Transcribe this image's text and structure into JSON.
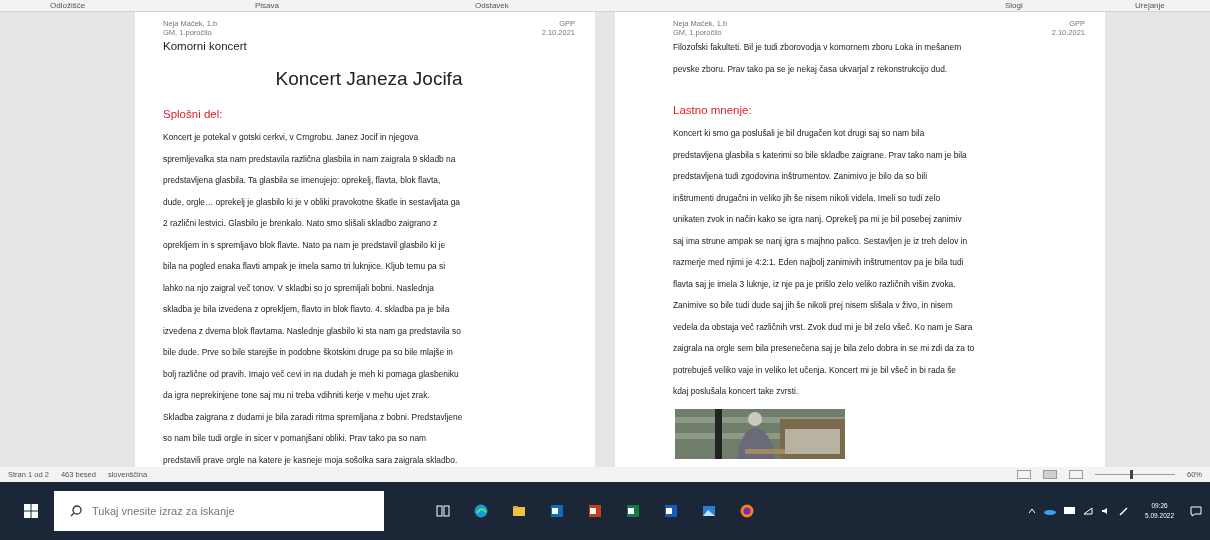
{
  "ribbon_groups": [
    "Odložišče",
    "Pisava",
    "Odstavek",
    "Slogi",
    "Urejanje"
  ],
  "pages": [
    {
      "header": {
        "author": "Neja Maček, 1.b",
        "subject": "GPP",
        "date": "2.10.2021",
        "report": "GM, 1.poročilo"
      },
      "blocks": [
        {
          "kind": "subtitle",
          "text": "Komorni koncert"
        },
        {
          "kind": "title",
          "text": "Koncert Janeza Jocifa"
        },
        {
          "kind": "heading",
          "text": "Splošni del:"
        },
        {
          "kind": "paragraph",
          "lines": [
            "Koncert je potekal v gotski cerkvi, v Crngrobu. Janez Jocif in njegova",
            "spremljevalka sta nam predstavila različna glasbila in nam zaigrala 9 skladb na",
            "predstavljena glasbila. Ta glasbila se imenujejo: oprekelj, flavta, blok flavta,",
            "dude, orgle… oprekelj je glasbilo ki je v obliki pravokotne škatle in sestavljata ga",
            "2 različni lestvici. Glasbilo je brenkalo. Nato smo slišali skladbo zaigrano z",
            "oprekljem in s spremljavo blok flavte. Nato pa nam je predstavil glasbilo ki je",
            "bila na pogled enaka flavti ampak je imela samo tri luknjice. Kljub temu pa si",
            "lahko na njo zaigral več tonov. V skladbi so jo spremljali bobni. Naslednja",
            "skladba je bila izvedena z oprekljem, flavto in blok flavto. 4. skladba pa je bila",
            "izvedena z dvema blok flavtama. Naslednje glasbilo ki sta nam ga predstavila so",
            "bile dude. Prve so bile starejše in podobne škotskim druge pa so bile mlajše in",
            "bolj različne od pravih. Imajo več cevi in na dudah je meh ki pomaga glasbeniku",
            "da igra neprekinjene tone saj mu ni treba vdihniti kerje v mehu ujet zrak.",
            "Skladba zaigrana z dudami je bila zaradi ritma spremljana z bobni. Predstavljene",
            "so nam bile tudi orgle in sicer v  pomanjšani obliki. Prav tako pa so nam",
            "predstavili prave orgle na katere je kasneje moja sošolka sara zaigrala skladbo."
          ]
        }
      ]
    },
    {
      "header": {
        "author": "Neja Maček, 1.b",
        "subject": "GPP",
        "date": "2.10.2021",
        "report": "GM, 1.poročilo"
      },
      "blocks": [
        {
          "kind": "paragraph",
          "lines": [
            "Filozofski fakulteti. Bil je tudi zborovodja v komornem zboru Loka in mešanem",
            "pevske zboru. Prav tako pa se je nekaj časa ukvarjal z rekonstrukcijo dud."
          ]
        },
        {
          "kind": "heading",
          "text": "Lastno mnenje:"
        },
        {
          "kind": "paragraph",
          "lines": [
            "Koncert ki smo ga poslušali je bil drugačen kot drugi saj so nam bila",
            "predstavljena glasbila s katerimi so bile skladbe zaigrane. Prav tako nam je bila",
            "predstavljena tudi zgodovina inštrumentov. Zanimivo je bilo da so bili",
            "inštrumenti drugačni in veliko jih še nisem nikoli videla. Imeli so tudi zelo",
            "unikaten zvok in način kako se igra nanj. Oprekelj pa mi je bil posebej zanimiv",
            "saj ima strune ampak se nanj igra s majhno palico. Sestavljen je iz treh delov in",
            "razmerje med njimi je 4:2:1. Eden najbolj zanimivih inštrumentov pa je bila tudi",
            "flavta saj je imela 3 luknje, iz nje pa je prišlo zelo veliko različnih višin zvoka.",
            "Zanimive so bile tudi dude saj jih še nikoli prej nisem slišala v živo, in nisem",
            "vedela da obstaja več različnih vrst. Zvok dud mi je bil zelo všeč. Ko nam je Sara",
            "zaigrala na orgle sem bila presenečena saj je bila zelo dobra in se mi zdi da za to",
            "potrebuješ veliko vaje in veliko let učenja. Koncert mi je bil všeč in bi rada še",
            "kdaj poslušala koncert take zvrsti."
          ]
        },
        {
          "kind": "picture"
        }
      ]
    }
  ],
  "status_bar": {
    "page": "Stran 1 od 2",
    "words": "463 besed",
    "language": "slovenščina",
    "zoom": "60%",
    "zoom_slider": {
      "level": 0.45
    }
  },
  "taskbar": {
    "search_placeholder": "Tukaj vnesite izraz za iskanje",
    "time": "09:26",
    "date": "5.09.2022"
  }
}
